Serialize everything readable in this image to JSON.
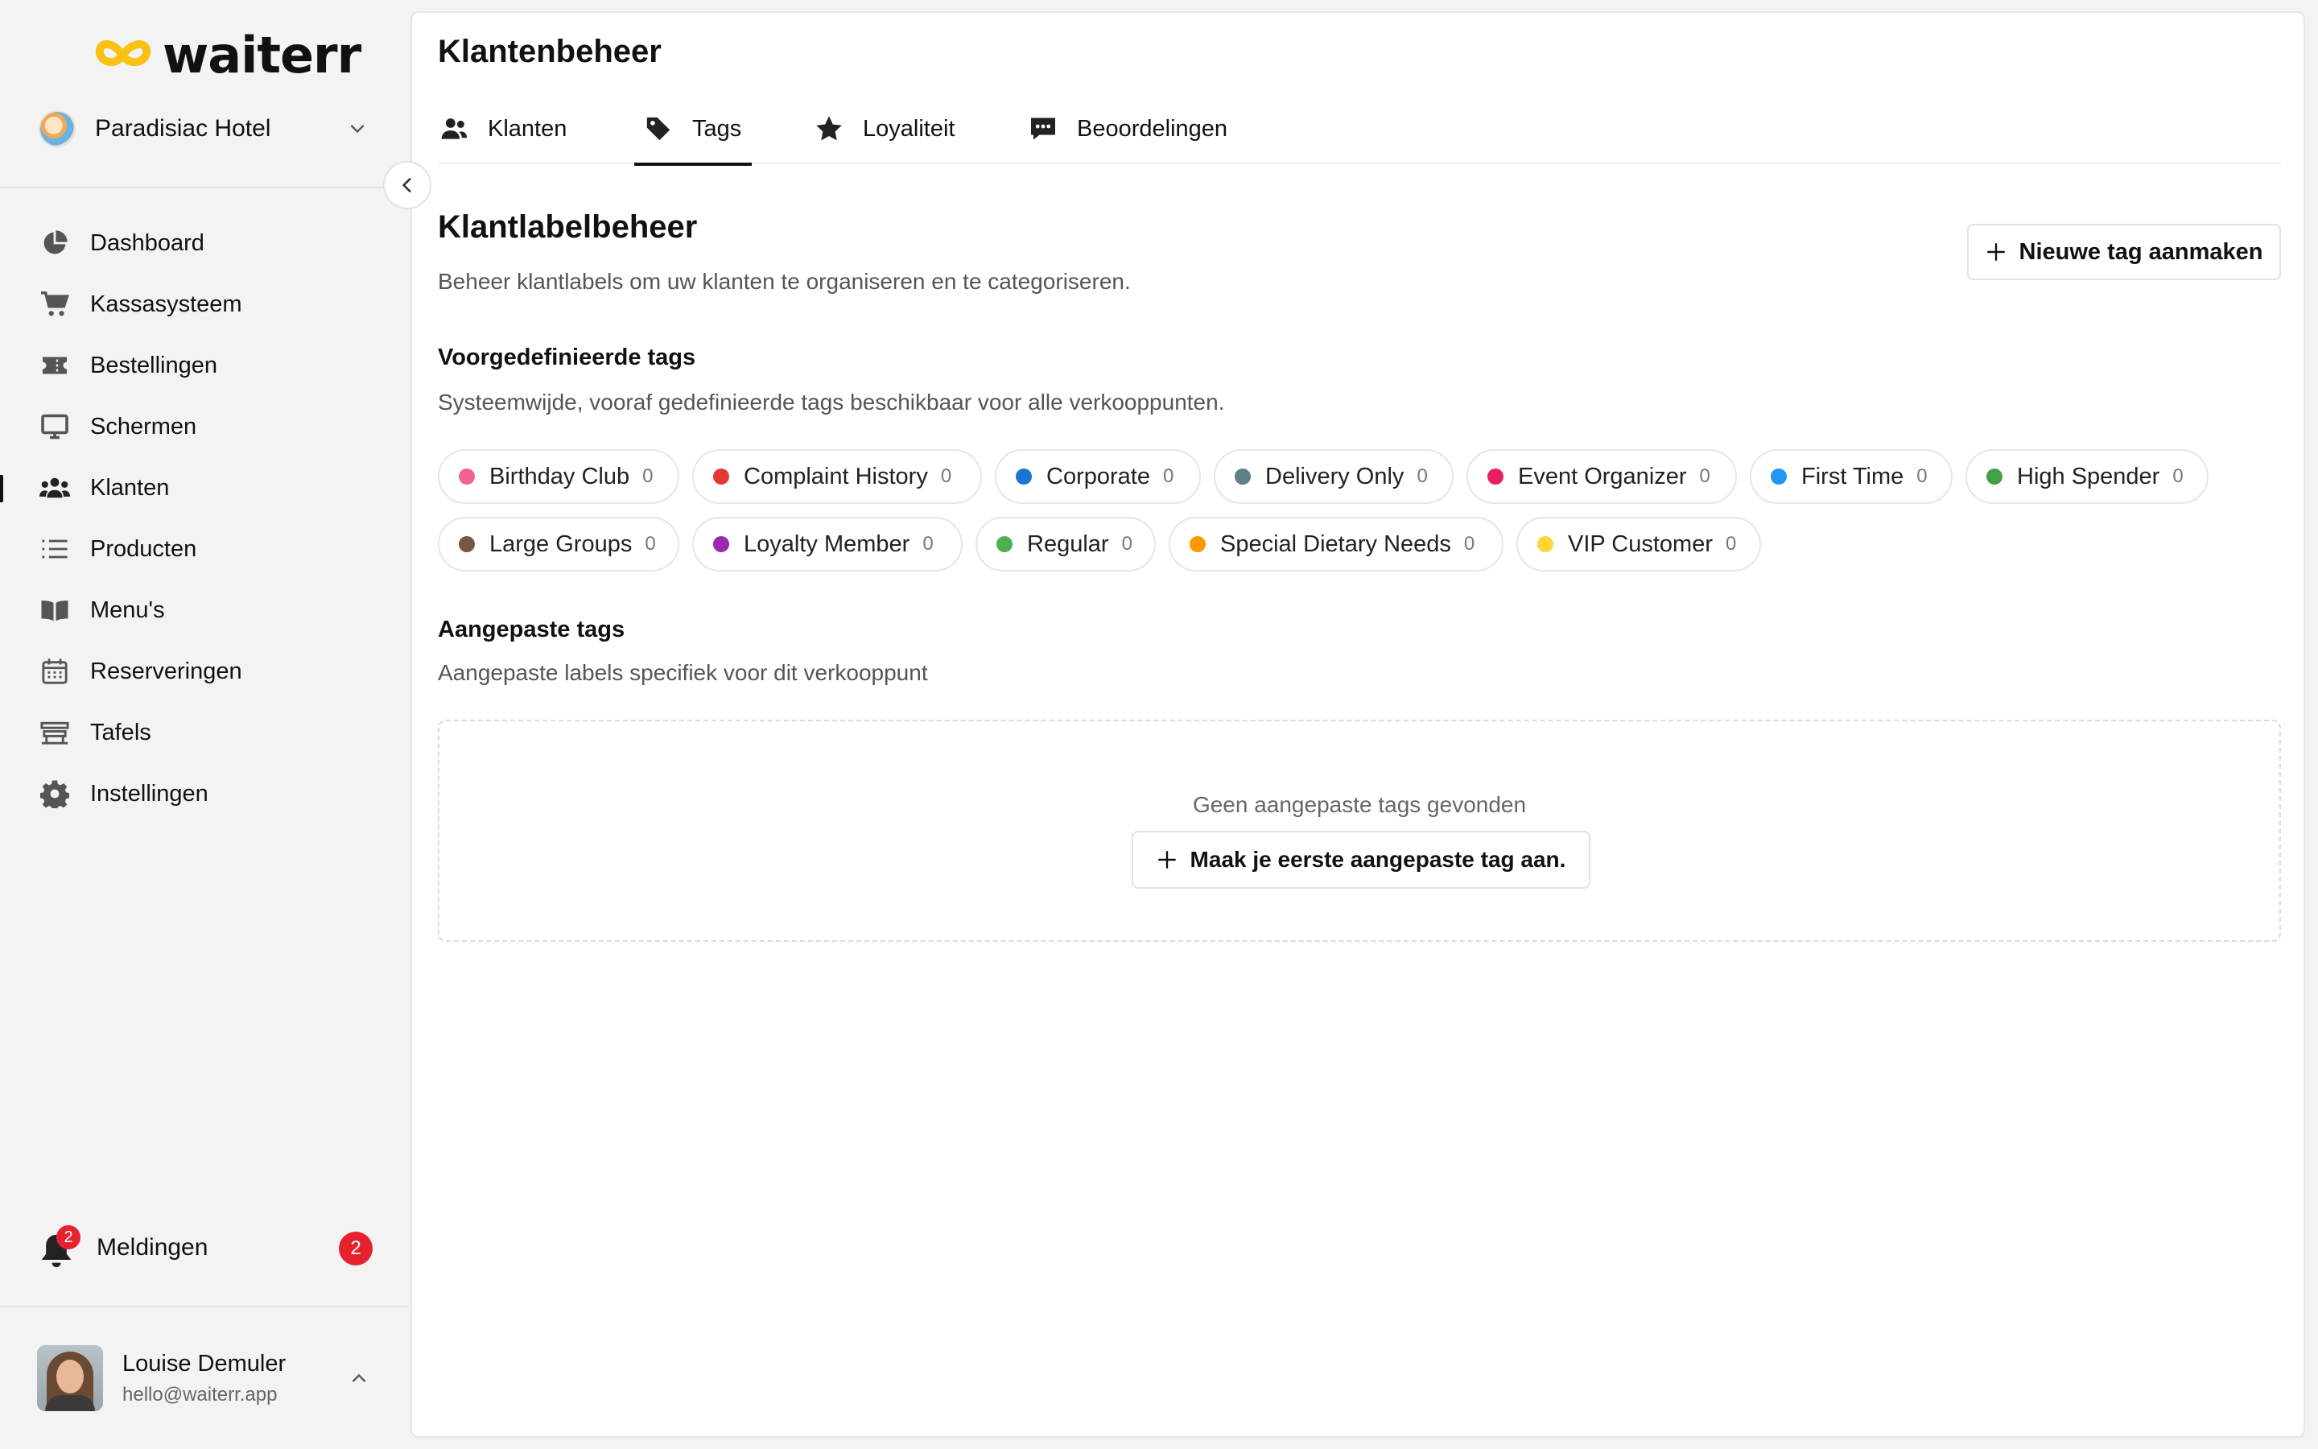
{
  "app": {
    "logo_text": "waiterr"
  },
  "venue": {
    "name": "Paradisiac Hotel"
  },
  "sidebar": {
    "items": [
      {
        "label": "Dashboard",
        "icon": "pie-chart-icon"
      },
      {
        "label": "Kassasysteem",
        "icon": "cart-icon"
      },
      {
        "label": "Bestellingen",
        "icon": "ticket-icon"
      },
      {
        "label": "Schermen",
        "icon": "monitor-icon"
      },
      {
        "label": "Klanten",
        "icon": "users-icon",
        "active": true
      },
      {
        "label": "Producten",
        "icon": "list-icon"
      },
      {
        "label": "Menu's",
        "icon": "book-icon"
      },
      {
        "label": "Reserveringen",
        "icon": "calendar-icon"
      },
      {
        "label": "Tafels",
        "icon": "table-icon"
      },
      {
        "label": "Instellingen",
        "icon": "gear-icon"
      }
    ],
    "notifications": {
      "label": "Meldingen",
      "badge": "2",
      "count": "2"
    },
    "user": {
      "name": "Louise Demuler",
      "email": "hello@waiterr.app"
    }
  },
  "page": {
    "title": "Klantenbeheer",
    "tabs": [
      {
        "label": "Klanten",
        "icon": "users-icon"
      },
      {
        "label": "Tags",
        "icon": "tag-icon",
        "active": true
      },
      {
        "label": "Loyaliteit",
        "icon": "star-icon"
      },
      {
        "label": "Beoordelingen",
        "icon": "review-icon"
      }
    ]
  },
  "tags_section": {
    "title": "Klantlabelbeheer",
    "subtitle": "Beheer klantlabels om uw klanten te organiseren en te categoriseren.",
    "new_button": "Nieuwe tag aanmaken",
    "predefined": {
      "title": "Voorgedefinieerde tags",
      "description": "Systeemwijde, vooraf gedefinieerde tags beschikbaar voor alle verkooppunten.",
      "tags": [
        {
          "name": "Birthday Club",
          "count": "0",
          "color": "#f06292"
        },
        {
          "name": "Complaint History",
          "count": "0",
          "color": "#e53935"
        },
        {
          "name": "Corporate",
          "count": "0",
          "color": "#1976d2"
        },
        {
          "name": "Delivery Only",
          "count": "0",
          "color": "#607d8b"
        },
        {
          "name": "Event Organizer",
          "count": "0",
          "color": "#e91e63"
        },
        {
          "name": "First Time",
          "count": "0",
          "color": "#2196f3"
        },
        {
          "name": "High Spender",
          "count": "0",
          "color": "#43a047"
        },
        {
          "name": "Large Groups",
          "count": "0",
          "color": "#795548"
        },
        {
          "name": "Loyalty Member",
          "count": "0",
          "color": "#9c27b0"
        },
        {
          "name": "Regular",
          "count": "0",
          "color": "#4caf50"
        },
        {
          "name": "Special Dietary Needs",
          "count": "0",
          "color": "#ff9800"
        },
        {
          "name": "VIP Customer",
          "count": "0",
          "color": "#fdd835"
        }
      ]
    },
    "custom": {
      "title": "Aangepaste tags",
      "description": "Aangepaste labels specifiek voor dit verkooppunt",
      "empty_text": "Geen aangepaste tags gevonden",
      "create_button": "Maak je eerste aangepaste tag aan."
    }
  }
}
